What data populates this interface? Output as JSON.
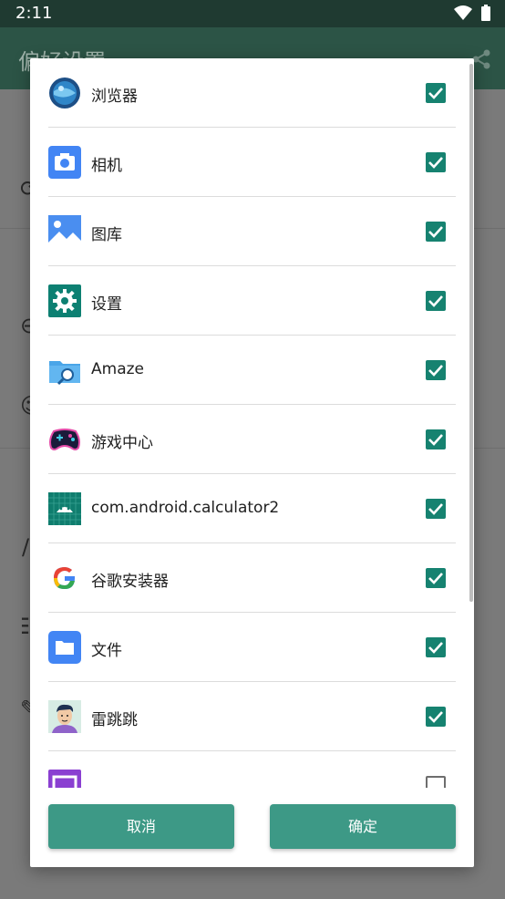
{
  "status_bar": {
    "time": "2:11"
  },
  "background": {
    "title": "偏好设置"
  },
  "apps": [
    {
      "name": "浏览器",
      "icon": "browser-icon",
      "checked": true
    },
    {
      "name": "相机",
      "icon": "camera-icon",
      "checked": true
    },
    {
      "name": "图库",
      "icon": "gallery-icon",
      "checked": true
    },
    {
      "name": "设置",
      "icon": "settings-icon",
      "checked": true
    },
    {
      "name": "Amaze",
      "icon": "amaze-folder-icon",
      "checked": true
    },
    {
      "name": "游戏中心",
      "icon": "game-center-icon",
      "checked": true
    },
    {
      "name": "com.android.calculator2",
      "icon": "android-icon",
      "checked": true
    },
    {
      "name": "谷歌安装器",
      "icon": "google-icon",
      "checked": true
    },
    {
      "name": "文件",
      "icon": "files-folder-icon",
      "checked": true
    },
    {
      "name": "雷跳跳",
      "icon": "avatar-icon",
      "checked": true
    },
    {
      "name": "",
      "icon": "purple-app-icon",
      "checked": false
    }
  ],
  "dialog": {
    "cancel_label": "取消",
    "ok_label": "确定"
  },
  "colors": {
    "accent": "#168270",
    "button": "#3d9986",
    "appbar": "#2c5446",
    "statusbar": "#1f3a31"
  }
}
